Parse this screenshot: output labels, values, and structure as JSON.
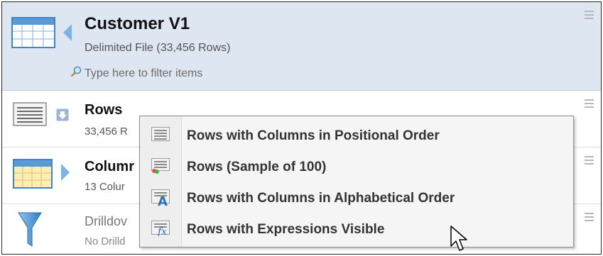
{
  "header": {
    "title": "Customer V1",
    "subtitle": "Delimited File  (33,456 Rows)",
    "filter_placeholder": "Type here to filter items"
  },
  "items": [
    {
      "title": "Rows",
      "subtitle": "33,456 R"
    },
    {
      "title": "Columr",
      "subtitle": "13 Colur"
    },
    {
      "title": "Drilldov",
      "subtitle": "No Drilld"
    }
  ],
  "context_menu": [
    {
      "label": "Rows with Columns in Positional Order",
      "icon": "rows-positional-icon"
    },
    {
      "label": "Rows (Sample of 100)",
      "icon": "rows-sample-icon"
    },
    {
      "label": "Rows with Columns in Alphabetical Order",
      "icon": "rows-alphabetical-icon"
    },
    {
      "label": "Rows with Expressions Visible",
      "icon": "rows-expressions-icon"
    }
  ],
  "colors": {
    "header_bg": "#dde6f1",
    "accent_blue": "#7fb2e5",
    "table_yellow": "#fbeeb0"
  }
}
